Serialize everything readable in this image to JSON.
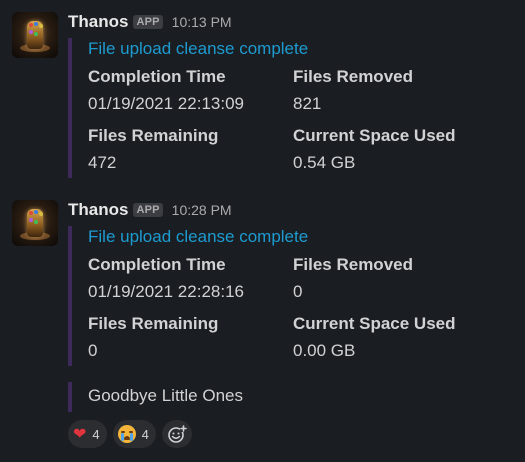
{
  "colors": {
    "background": "#1a1d21",
    "link": "#1d9bd1",
    "attachment_bar": "#3e2a5a",
    "text": "#d1d2d3",
    "muted": "#ababad"
  },
  "messages": [
    {
      "sender": "Thanos",
      "badge": "APP",
      "time": "10:13 PM",
      "attachment": {
        "title": "File upload cleanse complete",
        "fields": [
          {
            "label": "Completion Time",
            "value": "01/19/2021 22:13:09"
          },
          {
            "label": "Files Removed",
            "value": "821"
          },
          {
            "label": "Files Remaining",
            "value": "472"
          },
          {
            "label": "Current Space Used",
            "value": "0.54 GB"
          }
        ]
      }
    },
    {
      "sender": "Thanos",
      "badge": "APP",
      "time": "10:28 PM",
      "attachment": {
        "title": "File upload cleanse complete",
        "fields": [
          {
            "label": "Completion Time",
            "value": "01/19/2021 22:28:16"
          },
          {
            "label": "Files Removed",
            "value": "0"
          },
          {
            "label": "Files Remaining",
            "value": "0"
          },
          {
            "label": "Current Space Used",
            "value": "0.00 GB"
          }
        ]
      }
    }
  ],
  "followup": {
    "text": "Goodbye Little Ones"
  },
  "reactions": [
    {
      "icon": "red-heart-icon",
      "count": "4"
    },
    {
      "icon": "crying-face-icon",
      "count": "4"
    },
    {
      "icon": "add-reaction-icon"
    }
  ]
}
